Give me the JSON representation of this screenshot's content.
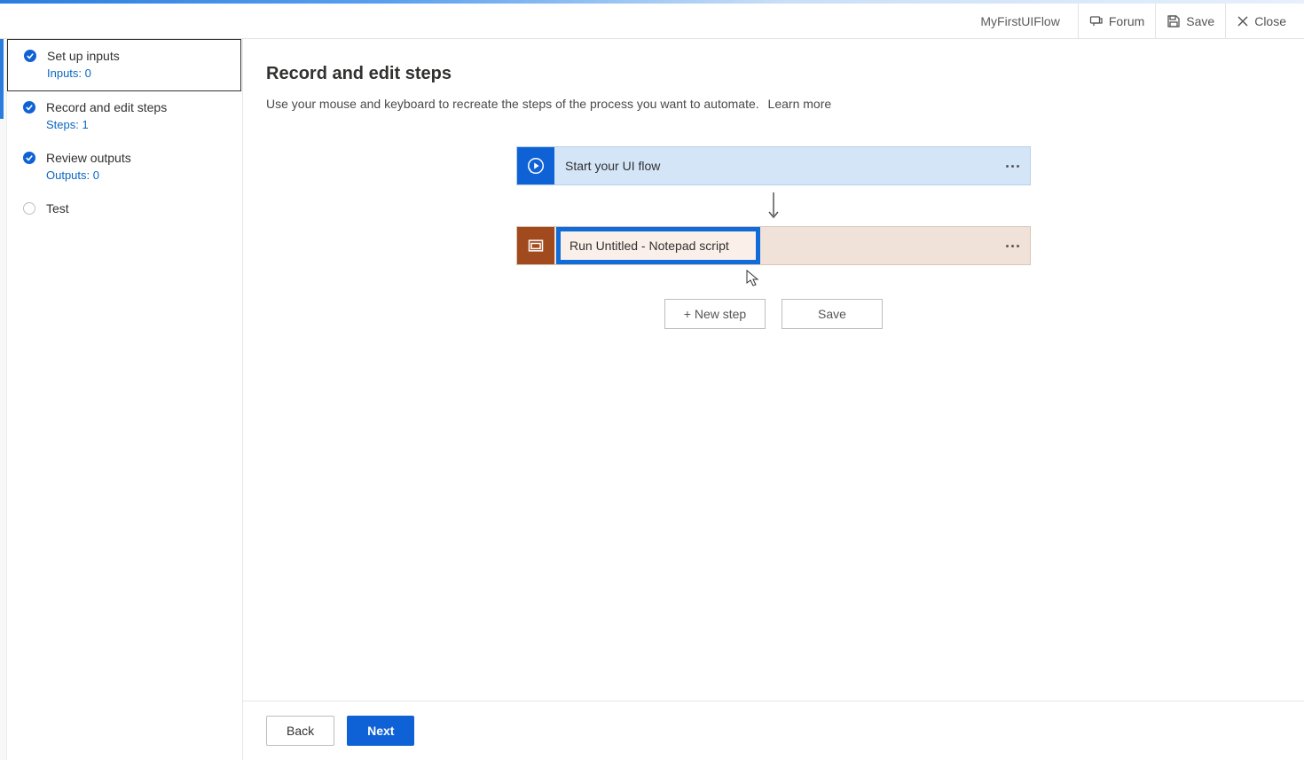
{
  "header": {
    "flow_name": "MyFirstUIFlow",
    "forum": "Forum",
    "save": "Save",
    "close": "Close"
  },
  "sidebar": {
    "items": [
      {
        "title": "Set up inputs",
        "sub": "Inputs: 0"
      },
      {
        "title": "Record and edit steps",
        "sub": "Steps: 1"
      },
      {
        "title": "Review outputs",
        "sub": "Outputs: 0"
      },
      {
        "title": "Test"
      }
    ]
  },
  "page": {
    "title": "Record and edit steps",
    "desc": "Use your mouse and keyboard to recreate the steps of the process you want to automate.",
    "learn_more": "Learn more"
  },
  "flow": {
    "start_label": "Start your UI flow",
    "script_label": "Run Untitled - Notepad script"
  },
  "actions": {
    "new_step": "+ New step",
    "save": "Save"
  },
  "footer": {
    "back": "Back",
    "next": "Next"
  }
}
